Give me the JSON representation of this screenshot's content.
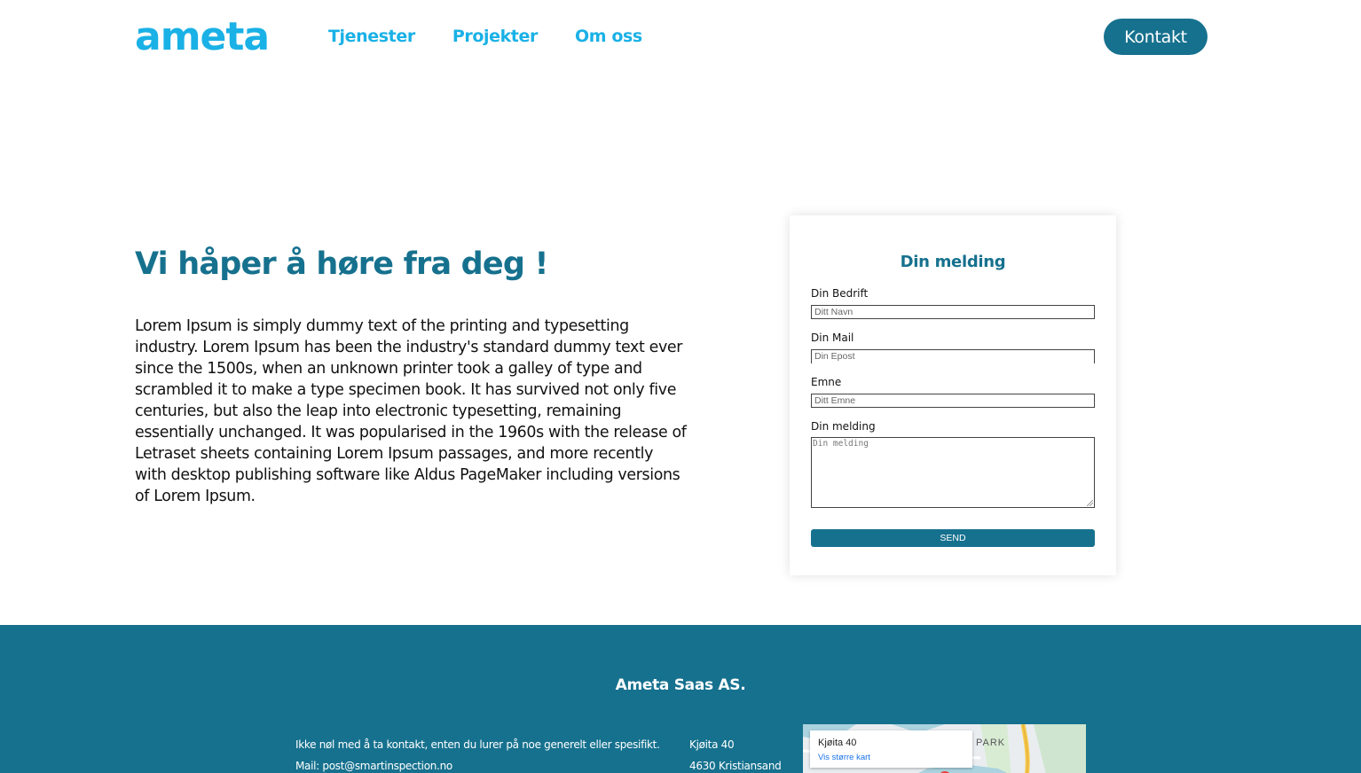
{
  "header": {
    "logo": "ameta",
    "nav": [
      "Tjenester",
      "Projekter",
      "Om oss"
    ],
    "contact_label": "Kontakt"
  },
  "hero": {
    "title": "Vi håper å høre fra deg !",
    "lines": [
      "Lorem Ipsum is simply dummy text of the printing and typesetting",
      "industry. Lorem Ipsum has been the industry's standard dummy text ever",
      "since the 1500s, when an unknown printer took a galley of type and",
      "scrambled it to make a type specimen book. It has survived not only five",
      "centuries, but also the leap into electronic typesetting, remaining",
      "essentially unchanged. It was popularised in the 1960s with the release of",
      "Letraset sheets containing Lorem Ipsum passages, and more recently",
      "with desktop publishing software like Aldus PageMaker including versions",
      "of Lorem Ipsum."
    ]
  },
  "form": {
    "title": "Din melding",
    "company_label": "Din Bedrift",
    "company_placeholder": "Ditt Navn",
    "mail_label": "Din Mail",
    "mail_placeholder": "Din Epost",
    "subject_label": "Emne",
    "subject_placeholder": "Ditt Emne",
    "message_label": "Din melding",
    "message_placeholder": "Din melding",
    "send_label": "SEND"
  },
  "footer": {
    "title": "Ameta Saas AS.",
    "text": "Ikke nøl med å ta kontakt, enten du lurer på noe generelt eller spesifikt.",
    "mail": "Mail: post@smartinspection.no",
    "address_street": "Kjøita 40",
    "address_city": "4630 Kristiansand",
    "map": {
      "place": "Kjøita 40",
      "link": "Vis større kart",
      "area": "PARK"
    }
  },
  "colors": {
    "brand_light": "#1ab1e6",
    "brand_dark": "#16718e"
  }
}
